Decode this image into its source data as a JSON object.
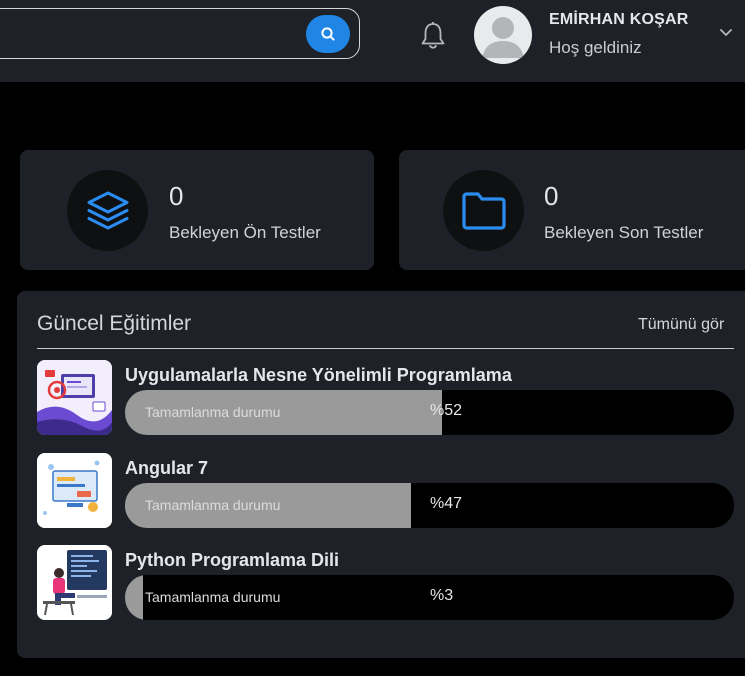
{
  "header": {
    "search": {
      "placeholder": "",
      "button_icon": "search-icon",
      "accent": "#1f86e6"
    },
    "notification_icon": "bell-icon",
    "user": {
      "name": "EMİRHAN KOŞAR",
      "greeting": "Hoş geldiniz",
      "menu_icon": "chevron-down-icon"
    }
  },
  "stats": [
    {
      "value": "0",
      "label": "Bekleyen Ön Testler",
      "icon": "layers-icon"
    },
    {
      "value": "0",
      "label": "Bekleyen Son Testler",
      "icon": "folder-icon"
    }
  ],
  "courses_panel": {
    "title": "Güncel Eğitimler",
    "see_all": "Tümünü gör",
    "progress_label": "Tamamlanma durumu",
    "items": [
      {
        "title": "Uygulamalarla Nesne Yönelimli Programlama",
        "percent_text": "%52",
        "progress": 0.52
      },
      {
        "title": "Angular 7",
        "percent_text": "%47",
        "progress": 0.47
      },
      {
        "title": "Python Programlama Dili",
        "percent_text": "%3",
        "progress": 0.03
      }
    ]
  }
}
